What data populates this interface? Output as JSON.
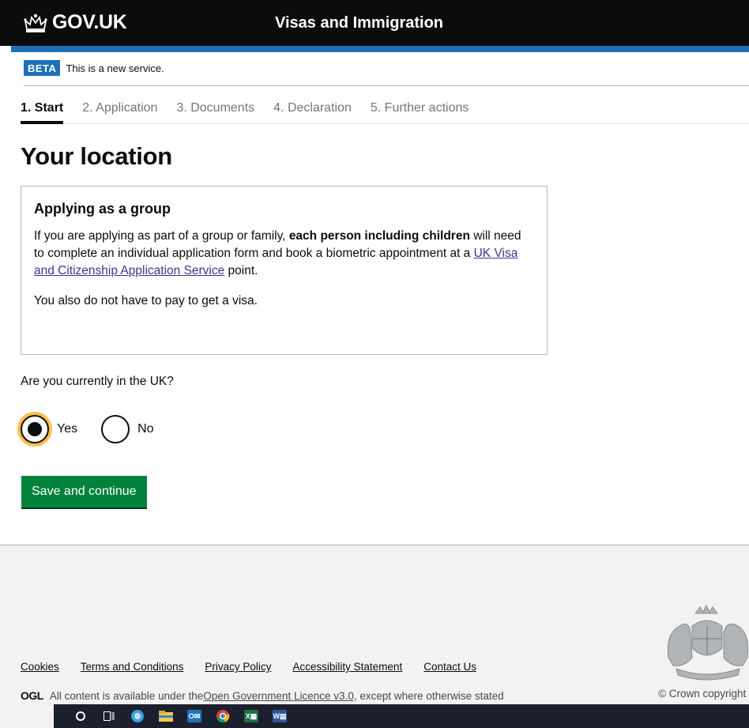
{
  "header": {
    "logo_text": "GOV.UK",
    "service_name": "Visas and Immigration",
    "colors": {
      "background": "#0b0c0c",
      "accent_bar": "#1d70b8"
    }
  },
  "phase_banner": {
    "tag": "BETA",
    "text": "This is a new service."
  },
  "steps": [
    {
      "label": "1. Start",
      "active": true
    },
    {
      "label": "2. Application",
      "active": false
    },
    {
      "label": "3. Documents",
      "active": false
    },
    {
      "label": "4. Declaration",
      "active": false
    },
    {
      "label": "5. Further actions",
      "active": false
    }
  ],
  "main": {
    "title": "Your location",
    "panel": {
      "heading": "Applying as a group",
      "p1_before": "If you are applying as part of a group or family, ",
      "p1_bold": "each person including children",
      "p1_middle": " will need to complete an individual application form and book a biometric appointment at a ",
      "p1_link": "UK Visa and Citizenship Application Service",
      "p1_after": " point.",
      "p2": "You also do not have to pay to get a visa."
    },
    "question": "Are you currently in the UK?",
    "options": [
      {
        "label": "Yes",
        "checked": true
      },
      {
        "label": "No",
        "checked": false
      }
    ],
    "submit_label": "Save and continue",
    "colors": {
      "button": "#00823b",
      "focus": "#ffbf47",
      "link": "#4c2c92"
    }
  },
  "footer": {
    "links": [
      "Cookies",
      "Terms and Conditions",
      "Privacy Policy",
      "Accessibility Statement",
      "Contact Us"
    ],
    "ogl": "OGL",
    "licence_before": "All content is available under the ",
    "licence_link": "Open Government Licence v3.0",
    "licence_after": ", except where otherwise stated",
    "copyright": "© Crown copyright"
  },
  "taskbar": {
    "icons": [
      "cortana-search-icon",
      "task-view-icon",
      "edge-browser-icon",
      "file-explorer-icon",
      "outlook-icon",
      "chrome-icon",
      "excel-icon",
      "word-icon"
    ]
  }
}
